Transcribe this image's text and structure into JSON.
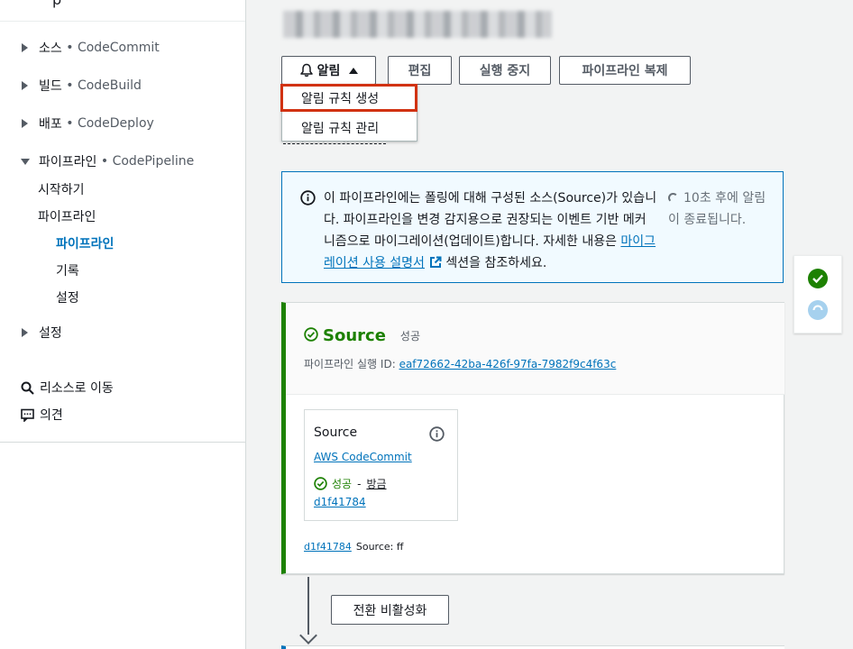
{
  "sidebar": {
    "top_cut_text": "p",
    "groups": [
      {
        "label": "소스",
        "service": "CodeCommit"
      },
      {
        "label": "빌드",
        "service": "CodeBuild"
      },
      {
        "label": "배포",
        "service": "CodeDeploy"
      },
      {
        "label": "파이프라인",
        "service": "CodePipeline"
      }
    ],
    "pipeline_sub": {
      "getting_started": "시작하기",
      "pipelines": "파이프라인",
      "pipelines_children": [
        "파이프라인",
        "기록",
        "설정"
      ]
    },
    "settings": "설정",
    "go_to_resource": "리소스로 이동",
    "feedback": "의견"
  },
  "toolbar": {
    "notify_label": "알림",
    "edit_label": "편집",
    "stop_label": "실행 중지",
    "clone_label": "파이프라인 복제"
  },
  "notify_menu": {
    "items": [
      "알림 규칙 생성",
      "알림 규칙 관리"
    ]
  },
  "obscured_text": "파이프라인 유형: V1",
  "banner": {
    "text_before_link": "이 파이프라인에는 폴링에 대해 구성된 소스(Source)가 있습니다. 파이프라인을 변경 감지용으로 권장되는 이벤트 기반 메커니즘으로 마이그레이션(업데이트)합니다. 자세한 내용은 ",
    "link_text": "마이그레이션 사용 설명서",
    "text_after_link": " 섹션을 참조하세요.",
    "countdown": "10초 후에 알림이 종료됩니다."
  },
  "stage": {
    "name": "Source",
    "status": "성공",
    "execution_label": "파이프라인 실행 ID:",
    "execution_id": "eaf72662-42ba-426f-97fa-7982f9c4f63c",
    "action": {
      "title": "Source",
      "provider": "AWS CodeCommit",
      "status": "성공",
      "separator": "-",
      "time": "방금",
      "commit": "d1f41784"
    },
    "footer_commit": "d1f41784",
    "footer_text": "Source: ff"
  },
  "transition": {
    "button_label": "전환 비활성화"
  },
  "colors": {
    "success": "#1d8102",
    "link": "#0073bb",
    "highlight": "#d13212",
    "banner_bg": "#f1faff",
    "pending": "#a6d1ee"
  },
  "icons": [
    "bell-icon",
    "caret-up-icon",
    "info-icon",
    "spinner-icon",
    "success-check-icon",
    "external-link-icon",
    "search-icon",
    "feedback-icon",
    "pending-status-icon"
  ]
}
